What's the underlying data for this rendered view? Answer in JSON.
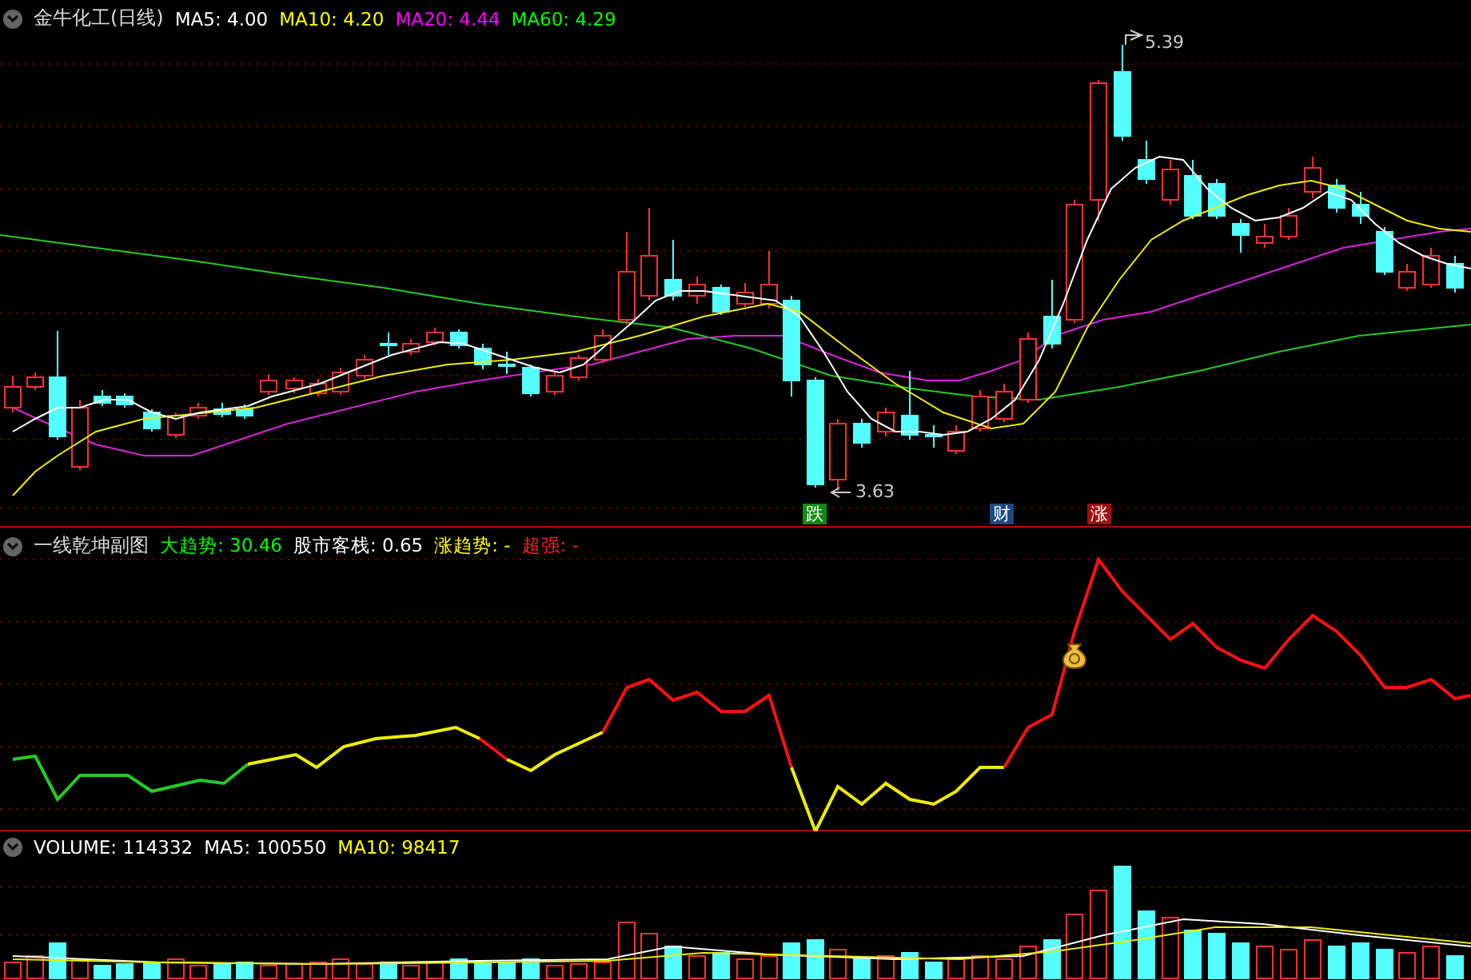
{
  "main_pane": {
    "title": "金牛化工(日线)",
    "indicators": [
      {
        "label": "MA5:",
        "value": "4.00",
        "color": "#ffffff"
      },
      {
        "label": "MA10:",
        "value": "4.20",
        "color": "#ffff00"
      },
      {
        "label": "MA20:",
        "value": "4.44",
        "color": "#ff00ff"
      },
      {
        "label": "MA60:",
        "value": "4.29",
        "color": "#00ff00"
      }
    ],
    "price_labels": [
      {
        "text": "5.39",
        "kind": "high"
      },
      {
        "text": "3.63",
        "kind": "low"
      }
    ],
    "event_markers": [
      {
        "text": "跌",
        "color": "#128a12"
      },
      {
        "text": "财",
        "color": "#1c4a80"
      },
      {
        "text": "涨",
        "color": "#a01010"
      }
    ]
  },
  "indicator_pane": {
    "title": "一线乾坤副图",
    "indicators": [
      {
        "label": "大趋势:",
        "value": "30.46",
        "color": "#00ff00"
      },
      {
        "label": "股市客栈:",
        "value": "0.65",
        "color": "#ffffff"
      },
      {
        "label": "涨趋势:",
        "value": "-",
        "color": "#ffff00"
      },
      {
        "label": "超强:",
        "value": "-",
        "color": "#ff2020"
      }
    ]
  },
  "volume_pane": {
    "indicators": [
      {
        "label": "VOLUME:",
        "value": "114332",
        "color": "#ffffff"
      },
      {
        "label": "MA5:",
        "value": "100550",
        "color": "#ffffff"
      },
      {
        "label": "MA10:",
        "value": "98417",
        "color": "#ffff00"
      }
    ]
  }
}
